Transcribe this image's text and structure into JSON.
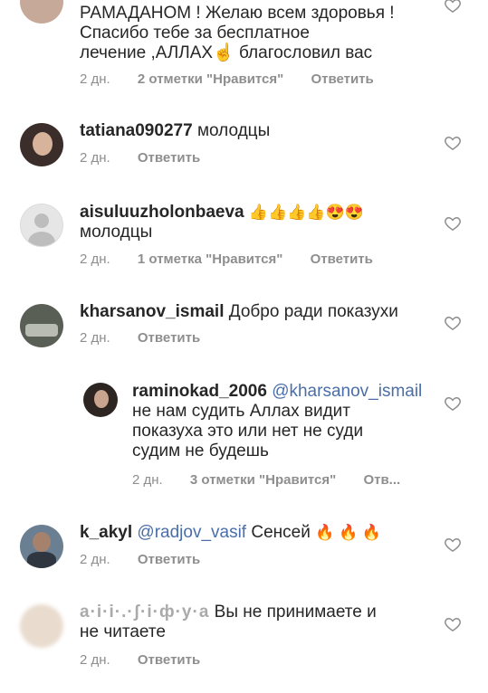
{
  "comments": [
    {
      "id": "c0",
      "username": "",
      "text_lines": [
        "РАМАДАНОМ ! Желаю всем здоровья !",
        "Спасибо тебе за  бесплатное",
        "лечение ,АЛЛАХ☝ благословил вас"
      ],
      "time": "2 дн.",
      "likes": "2 отметки \"Нравится\"",
      "reply": "Ответить"
    },
    {
      "id": "c1",
      "username": "tatiana090277",
      "text": "молодцы",
      "time": "2 дн.",
      "reply": "Ответить"
    },
    {
      "id": "c2",
      "username": "aisuluuzholonbaeva",
      "emoji": "👍👍👍👍😍😍",
      "text_line2": "молодцы",
      "time": "2 дн.",
      "likes": "1 отметка \"Нравится\"",
      "reply": "Ответить"
    },
    {
      "id": "c3",
      "username": "kharsanov_ismail",
      "text": "Добро ради показухи",
      "time": "2 дн.",
      "reply": "Ответить"
    },
    {
      "id": "c4",
      "username": "raminokad_2006",
      "mention": "@kharsanov_ismail",
      "text_lines": [
        "не нам судить Аллах видит",
        "показуха это или нет не суди",
        "судим не будешь"
      ],
      "time": "2 дн.",
      "likes": "3 отметки \"Нравится\"",
      "reply": "Отв..."
    },
    {
      "id": "c5",
      "username": "k_akyl",
      "mention": "@radjov_vasif",
      "text": "Сенсей",
      "emoji": "🔥 🔥 🔥",
      "time": "2 дн.",
      "reply": "Ответить"
    },
    {
      "id": "c6",
      "username_blurred": "a·i·i·.·ʃ·i·ф·y·a",
      "text_line1": "Вы не принимаете и",
      "text_line2": "не читаете",
      "time": "2 дн.",
      "reply": "Ответить"
    }
  ],
  "icons": {
    "like": "heart-outline-icon"
  },
  "colors": {
    "text": "#262626",
    "meta": "#8e8e8e",
    "mention": "#4a6ea9",
    "heart": "#8e8e8e"
  }
}
